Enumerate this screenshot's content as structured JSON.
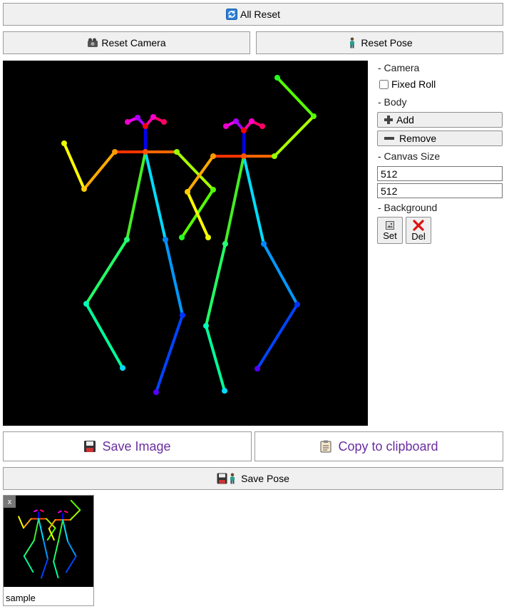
{
  "toolbar": {
    "all_reset_label": "All Reset",
    "reset_camera_label": "Reset Camera",
    "reset_pose_label": "Reset Pose"
  },
  "panel": {
    "camera_heading": "- Camera",
    "fixed_roll_label": "Fixed Roll",
    "fixed_roll_checked": false,
    "body_heading": "- Body",
    "add_label": "Add",
    "remove_label": "Remove",
    "canvas_size_heading": "- Canvas Size",
    "width_value": "512",
    "height_value": "512",
    "background_heading": "- Background",
    "set_label": "Set",
    "del_label": "Del"
  },
  "actions": {
    "save_image_label": "Save Image",
    "copy_clipboard_label": "Copy to clipboard",
    "save_pose_label": "Save Pose"
  },
  "thumbnail": {
    "close_label": "x",
    "name": "sample"
  },
  "colors": {
    "canvas_bg": "#000000",
    "link_text": "#6a2fa0",
    "button_bg": "#f0f0f0"
  },
  "icons": {
    "all_reset": "refresh-icon",
    "reset_camera": "camera-icon",
    "reset_pose": "person-icon",
    "add": "plus-icon",
    "remove": "minus-icon",
    "set": "image-icon",
    "del": "delete-x-icon",
    "save_image": "floppy-disk-icon",
    "copy_clipboard": "clipboard-icon",
    "save_pose": "floppy-person-icon"
  }
}
